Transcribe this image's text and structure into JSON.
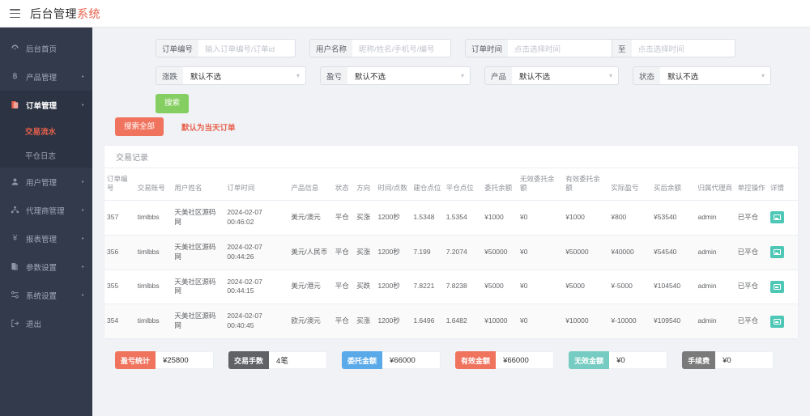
{
  "header": {
    "menu_icon": "hamburger-icon",
    "title_main": "后台管理",
    "title_accent": "系统"
  },
  "sidebar": {
    "items": [
      {
        "label": "后台首页",
        "icon": "dashboard-icon",
        "arrow": "",
        "active": false
      },
      {
        "label": "产品管理",
        "icon": "bitcoin-icon",
        "arrow": "▸",
        "active": false
      },
      {
        "label": "订单管理",
        "icon": "order-icon",
        "arrow": "▸",
        "active": true
      },
      {
        "label": "用户管理",
        "icon": "user-icon",
        "arrow": "▸",
        "active": false
      },
      {
        "label": "代理商管理",
        "icon": "agent-icon",
        "arrow": "▸",
        "active": false
      },
      {
        "label": "报表管理",
        "icon": "yen-icon",
        "arrow": "▸",
        "active": false
      },
      {
        "label": "参数设置",
        "icon": "params-icon",
        "arrow": "▸",
        "active": false
      },
      {
        "label": "系统设置",
        "icon": "settings-icon",
        "arrow": "▸",
        "active": false
      },
      {
        "label": "退出",
        "icon": "logout-icon",
        "arrow": "",
        "active": false
      }
    ],
    "sub_items": [
      {
        "label": "交易流水",
        "current": true
      },
      {
        "label": "平仓日志",
        "current": false
      }
    ]
  },
  "filters": {
    "order_no": {
      "label": "订单编号",
      "placeholder": "输入订单编号/订单id",
      "value": ""
    },
    "user_name": {
      "label": "用户名称",
      "placeholder": "昵称/姓名/手机号/编号",
      "value": ""
    },
    "order_time": {
      "label": "订单时间",
      "placeholder_start": "点击选择时间",
      "separator": "至",
      "placeholder_end": "点击选择时间"
    },
    "rise_fall": {
      "label": "涨跌",
      "value": "默认不选"
    },
    "profit_loss": {
      "label": "盈亏",
      "value": "默认不选"
    },
    "product": {
      "label": "产品",
      "value": "默认不选"
    },
    "status": {
      "label": "状态",
      "value": "默认不选"
    }
  },
  "actions": {
    "search_label": "搜索",
    "search_all_label": "搜索全部",
    "hint": "默认为当天订单"
  },
  "card": {
    "title": "交易记录"
  },
  "table": {
    "columns": [
      "订单编号",
      "交易账号",
      "用户姓名",
      "订单时间",
      "产品信息",
      "状态",
      "方向",
      "时间/点数",
      "建仓点位",
      "平仓点位",
      "委托余额",
      "无效委托余额",
      "有效委托余额",
      "实际盈亏",
      "买后余额",
      "归属代理商",
      "单控操作",
      "详情"
    ],
    "rows": [
      {
        "order_no": "357",
        "account": "timlbbs",
        "user_name": "天美社区源码网",
        "order_time_date": "2024-02-07",
        "order_time_clock": "00:46:02",
        "product": "美元/澳元",
        "status": "平仓",
        "direction": "买涨",
        "direction_color": "#e8604c",
        "duration": "1200秒",
        "open_point": "1.5348",
        "close_point": "1.5354",
        "close_point_color": "#e8604c",
        "entrust_balance": "¥1000",
        "invalid_entrust": "¥0",
        "valid_entrust": "¥1000",
        "actual_pl": "¥800",
        "actual_pl_color": "#e8604c",
        "balance_after": "¥53540",
        "agent": "admin",
        "control": "已平仓",
        "detail_icon": "detail-icon"
      },
      {
        "order_no": "356",
        "account": "timlbbs",
        "user_name": "天美社区源码网",
        "order_time_date": "2024-02-07",
        "order_time_clock": "00:44:26",
        "product": "美元/人民币",
        "status": "平仓",
        "direction": "买涨",
        "direction_color": "#e8604c",
        "duration": "1200秒",
        "open_point": "7.199",
        "close_point": "7.2074",
        "close_point_color": "#e8604c",
        "entrust_balance": "¥50000",
        "invalid_entrust": "¥0",
        "valid_entrust": "¥50000",
        "actual_pl": "¥40000",
        "actual_pl_color": "#e8604c",
        "balance_after": "¥54540",
        "agent": "admin",
        "control": "已平仓",
        "detail_icon": "detail-icon"
      },
      {
        "order_no": "355",
        "account": "timlbbs",
        "user_name": "天美社区源码网",
        "order_time_date": "2024-02-07",
        "order_time_clock": "00:44:15",
        "product": "美元/港元",
        "status": "平仓",
        "direction": "买跌",
        "direction_color": "#5daf34",
        "duration": "1200秒",
        "open_point": "7.8221",
        "close_point": "7.8238",
        "close_point_color": "#e8604c",
        "entrust_balance": "¥5000",
        "invalid_entrust": "¥0",
        "valid_entrust": "¥5000",
        "actual_pl": "¥-5000",
        "actual_pl_color": "#5daf34",
        "balance_after": "¥104540",
        "agent": "admin",
        "control": "已平仓",
        "detail_icon": "detail-icon"
      },
      {
        "order_no": "354",
        "account": "timlbbs",
        "user_name": "天美社区源码网",
        "order_time_date": "2024-02-07",
        "order_time_clock": "00:40:45",
        "product": "欧元/澳元",
        "status": "平仓",
        "direction": "买涨",
        "direction_color": "#e8604c",
        "duration": "1200秒",
        "open_point": "1.6496",
        "close_point": "1.6482",
        "close_point_color": "#5daf34",
        "entrust_balance": "¥10000",
        "invalid_entrust": "¥0",
        "valid_entrust": "¥10000",
        "actual_pl": "¥-10000",
        "actual_pl_color": "#5daf34",
        "balance_after": "¥109540",
        "agent": "admin",
        "control": "已平仓",
        "detail_icon": "detail-icon"
      }
    ]
  },
  "summary": [
    {
      "tag": "盈亏统计",
      "value": "¥25800",
      "color": "#f0735e"
    },
    {
      "tag": "交易手数",
      "value": "4笔",
      "color": "#606266"
    },
    {
      "tag": "委托金额",
      "value": "¥66000",
      "color": "#5aaaea"
    },
    {
      "tag": "有效金额",
      "value": "¥66000",
      "color": "#f0735e"
    },
    {
      "tag": "无效金额",
      "value": "¥0",
      "color": "#76ccc2"
    },
    {
      "tag": "手续费",
      "value": "¥0",
      "color": "#7a7a7a"
    }
  ],
  "colors": {
    "accent": "#e8604c",
    "sidebar_bg": "#323a4b",
    "page_bg": "#f0f2f5",
    "green": "#5daf34",
    "teal": "#4ec7b6"
  }
}
